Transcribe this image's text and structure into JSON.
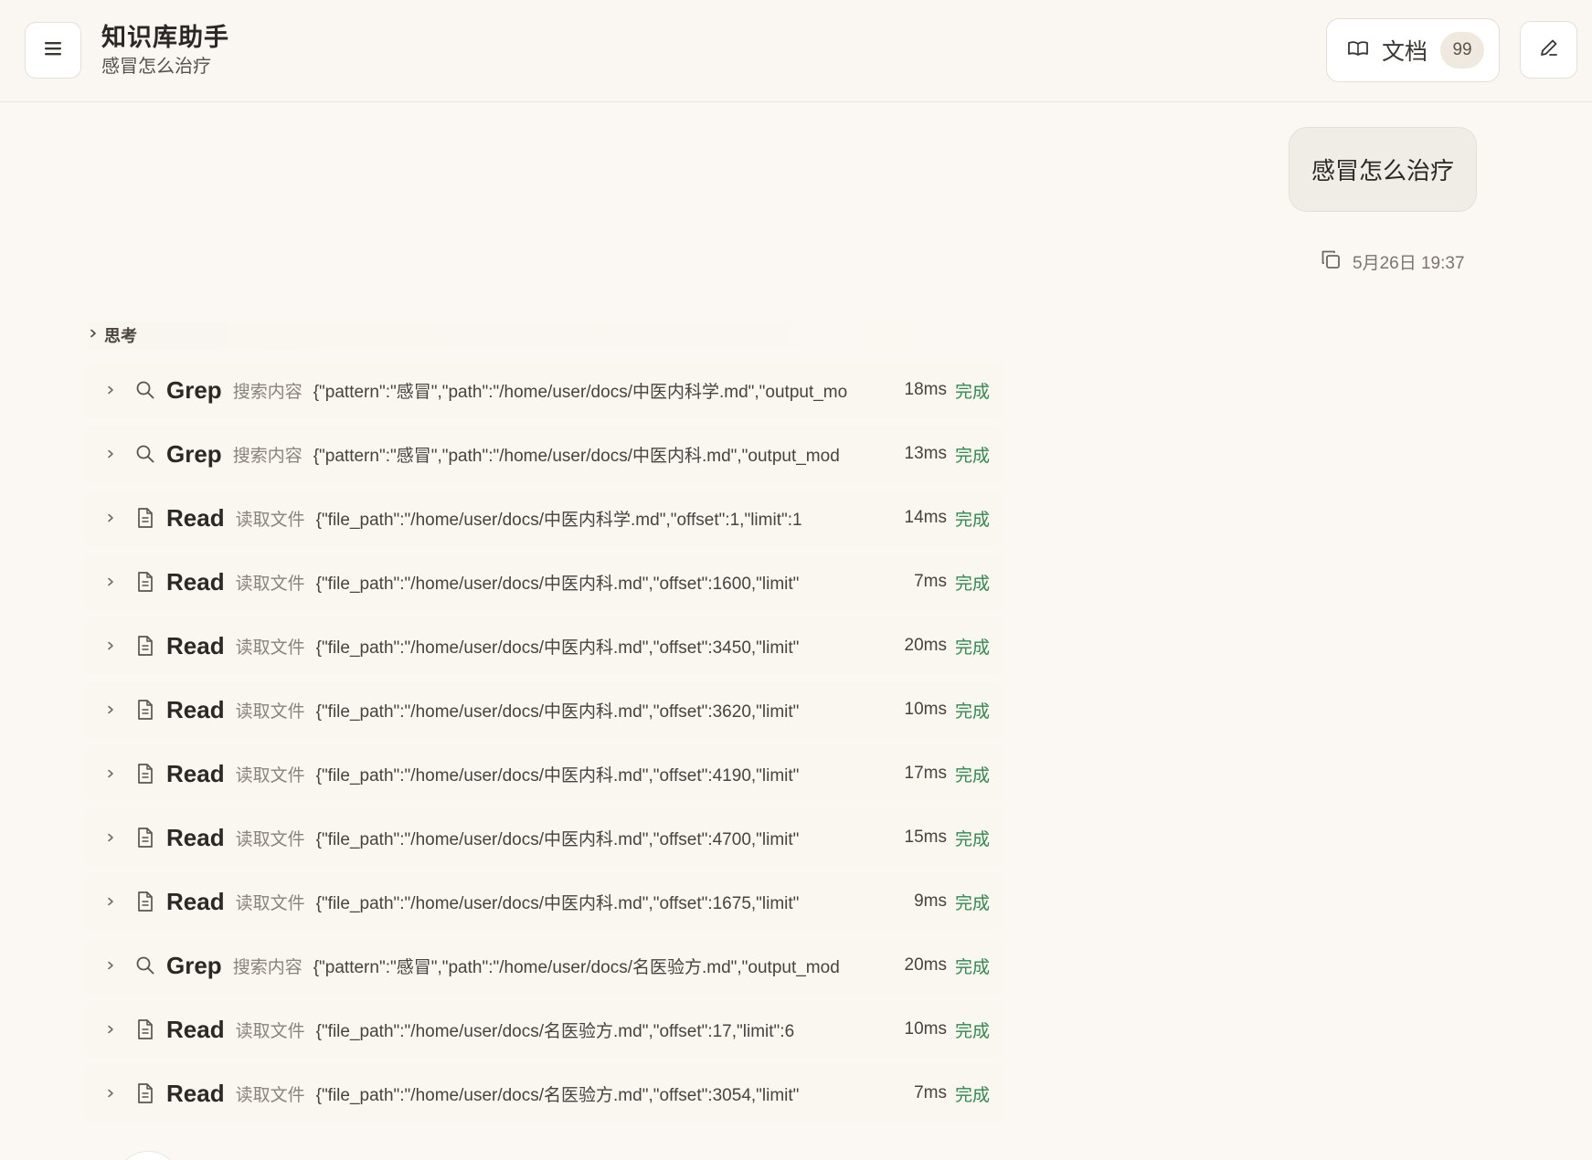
{
  "header": {
    "menu_icon": "hamburger-icon",
    "title": "知识库助手",
    "subtitle": "感冒怎么治疗",
    "docs_button": {
      "icon": "book-icon",
      "label": "文档",
      "count": "99"
    },
    "edit_icon": "pencil-icon"
  },
  "conversation": {
    "user_message": "感冒怎么治疗",
    "copy_icon": "copy-icon",
    "timestamp": "5月26日 19:37",
    "thinking_label": "思考",
    "tool_calls": [
      {
        "icon": "search-icon",
        "name": "Grep",
        "desc": "搜索内容",
        "args": "{\"pattern\":\"感冒\",\"path\":\"/home/user/docs/中医内科学.md\",\"output_mo",
        "time": "18ms",
        "status": "完成"
      },
      {
        "icon": "search-icon",
        "name": "Grep",
        "desc": "搜索内容",
        "args": "{\"pattern\":\"感冒\",\"path\":\"/home/user/docs/中医内科.md\",\"output_mod",
        "time": "13ms",
        "status": "完成"
      },
      {
        "icon": "file-icon",
        "name": "Read",
        "desc": "读取文件",
        "args": "{\"file_path\":\"/home/user/docs/中医内科学.md\",\"offset\":1,\"limit\":1",
        "time": "14ms",
        "status": "完成"
      },
      {
        "icon": "file-icon",
        "name": "Read",
        "desc": "读取文件",
        "args": "{\"file_path\":\"/home/user/docs/中医内科.md\",\"offset\":1600,\"limit\"",
        "time": "7ms",
        "status": "完成"
      },
      {
        "icon": "file-icon",
        "name": "Read",
        "desc": "读取文件",
        "args": "{\"file_path\":\"/home/user/docs/中医内科.md\",\"offset\":3450,\"limit\"",
        "time": "20ms",
        "status": "完成"
      },
      {
        "icon": "file-icon",
        "name": "Read",
        "desc": "读取文件",
        "args": "{\"file_path\":\"/home/user/docs/中医内科.md\",\"offset\":3620,\"limit\"",
        "time": "10ms",
        "status": "完成"
      },
      {
        "icon": "file-icon",
        "name": "Read",
        "desc": "读取文件",
        "args": "{\"file_path\":\"/home/user/docs/中医内科.md\",\"offset\":4190,\"limit\"",
        "time": "17ms",
        "status": "完成"
      },
      {
        "icon": "file-icon",
        "name": "Read",
        "desc": "读取文件",
        "args": "{\"file_path\":\"/home/user/docs/中医内科.md\",\"offset\":4700,\"limit\"",
        "time": "15ms",
        "status": "完成"
      },
      {
        "icon": "file-icon",
        "name": "Read",
        "desc": "读取文件",
        "args": "{\"file_path\":\"/home/user/docs/中医内科.md\",\"offset\":1675,\"limit\"",
        "time": "9ms",
        "status": "完成"
      },
      {
        "icon": "search-icon",
        "name": "Grep",
        "desc": "搜索内容",
        "args": "{\"pattern\":\"感冒\",\"path\":\"/home/user/docs/名医验方.md\",\"output_mod",
        "time": "20ms",
        "status": "完成"
      },
      {
        "icon": "file-icon",
        "name": "Read",
        "desc": "读取文件",
        "args": "{\"file_path\":\"/home/user/docs/名医验方.md\",\"offset\":17,\"limit\":6",
        "time": "10ms",
        "status": "完成"
      },
      {
        "icon": "file-icon",
        "name": "Read",
        "desc": "读取文件",
        "args": "{\"file_path\":\"/home/user/docs/名医验方.md\",\"offset\":3054,\"limit\"",
        "time": "7ms",
        "status": "完成"
      }
    ]
  },
  "colors": {
    "background": "#fbf8f3",
    "status_done": "#2f8a4f",
    "muted_text": "#8a847b"
  }
}
